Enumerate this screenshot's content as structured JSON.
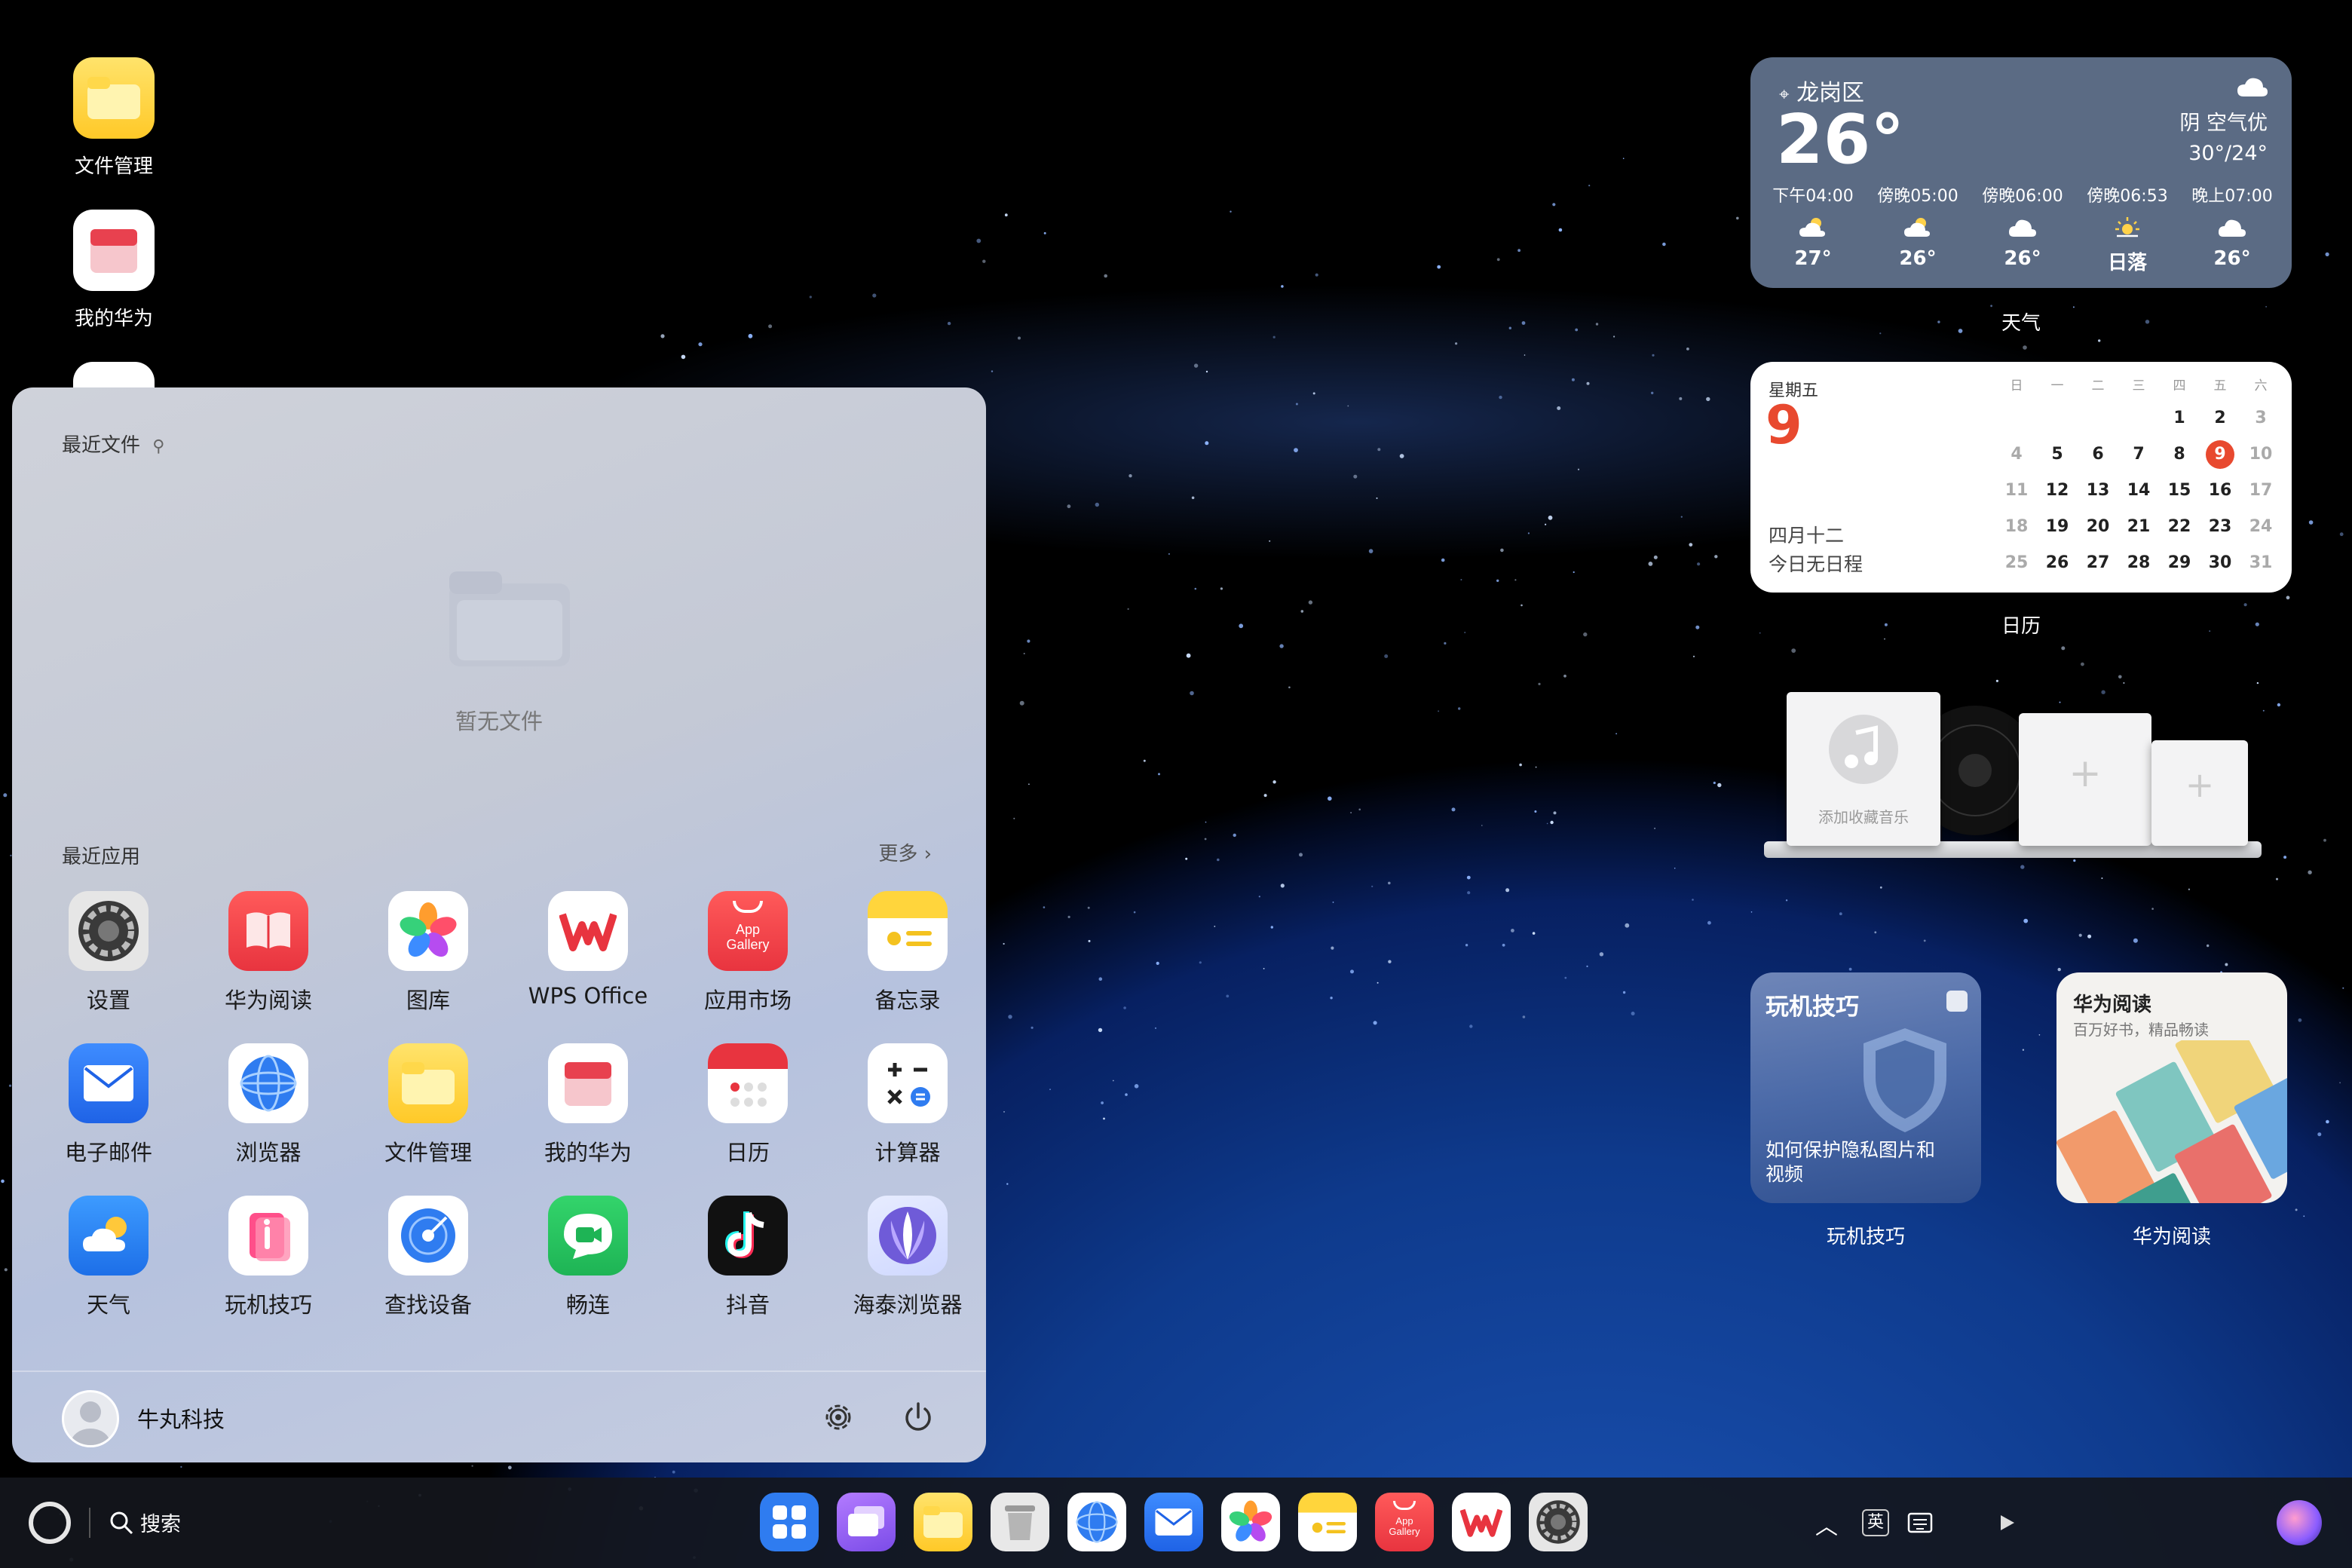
{
  "desktop": {
    "icons": [
      {
        "label": "文件管理",
        "icon": "file-manager-icon"
      },
      {
        "label": "我的华为",
        "icon": "my-huawei-icon"
      }
    ]
  },
  "start_menu": {
    "recent_files_title": "最近文件",
    "empty_text": "暂无文件",
    "recent_apps_title": "最近应用",
    "more_label": "更多",
    "apps": [
      {
        "label": "设置",
        "icon": "settings-icon"
      },
      {
        "label": "华为阅读",
        "icon": "huawei-books-icon"
      },
      {
        "label": "图库",
        "icon": "gallery-icon"
      },
      {
        "label": "WPS Office",
        "icon": "wps-office-icon"
      },
      {
        "label": "应用市场",
        "icon": "app-gallery-icon"
      },
      {
        "label": "备忘录",
        "icon": "notes-icon"
      },
      {
        "label": "电子邮件",
        "icon": "email-icon"
      },
      {
        "label": "浏览器",
        "icon": "browser-icon"
      },
      {
        "label": "文件管理",
        "icon": "file-manager-icon"
      },
      {
        "label": "我的华为",
        "icon": "my-huawei-icon"
      },
      {
        "label": "日历",
        "icon": "calendar-icon"
      },
      {
        "label": "计算器",
        "icon": "calculator-icon"
      },
      {
        "label": "天气",
        "icon": "weather-icon"
      },
      {
        "label": "玩机技巧",
        "icon": "tips-icon"
      },
      {
        "label": "查找设备",
        "icon": "find-device-icon"
      },
      {
        "label": "畅连",
        "icon": "meetime-icon"
      },
      {
        "label": "抖音",
        "icon": "douyin-icon"
      },
      {
        "label": "海泰浏览器",
        "icon": "haitai-browser-icon"
      }
    ],
    "app_gallery_text_1": "App",
    "app_gallery_text_2": "Gallery",
    "user_name": "牛丸科技"
  },
  "weather": {
    "location": "龙岗区",
    "temperature": "26°",
    "condition": "阴  空气优",
    "range": "30°/24°",
    "hourly": [
      {
        "time": "下午04:00",
        "icon": "partly-cloudy-icon",
        "temp": "27°"
      },
      {
        "time": "傍晚05:00",
        "icon": "partly-cloudy-icon",
        "temp": "26°"
      },
      {
        "time": "傍晚06:00",
        "icon": "cloud-icon",
        "temp": "26°"
      },
      {
        "time": "傍晚06:53",
        "icon": "sunset-icon",
        "temp": "日落"
      },
      {
        "time": "晚上07:00",
        "icon": "cloud-icon",
        "temp": "26°"
      }
    ],
    "caption": "天气"
  },
  "calendar": {
    "weekday": "星期五",
    "day": "9",
    "lunar": "四月十二",
    "no_events": "今日无日程",
    "week_headers": [
      "日",
      "一",
      "二",
      "三",
      "四",
      "五",
      "六"
    ],
    "rows": [
      [
        "",
        "",
        "",
        "",
        "1",
        "2",
        "3"
      ],
      [
        "4",
        "5",
        "6",
        "7",
        "8",
        "9",
        "10"
      ],
      [
        "11",
        "12",
        "13",
        "14",
        "15",
        "16",
        "17"
      ],
      [
        "18",
        "19",
        "20",
        "21",
        "22",
        "23",
        "24"
      ],
      [
        "25",
        "26",
        "27",
        "28",
        "29",
        "30",
        "31"
      ]
    ],
    "today": "9",
    "accent": "#e8492f",
    "caption": "日历"
  },
  "music": {
    "add_label": "添加收藏音乐"
  },
  "tips_widget": {
    "title": "玩机技巧",
    "desc_line1": "如何保护隐私图片和",
    "desc_line2": "视频",
    "caption": "玩机技巧"
  },
  "reader_widget": {
    "title": "华为阅读",
    "subtitle": "百万好书，精品畅读",
    "caption": "华为阅读"
  },
  "taskbar": {
    "search_label": "搜索",
    "input_method": "英",
    "apps": [
      "app-center-icon",
      "multi-window-icon",
      "file-manager-icon",
      "trash-icon",
      "browser-icon",
      "email-icon",
      "gallery-icon",
      "notes-icon",
      "app-gallery-icon",
      "wps-office-icon",
      "settings-icon"
    ]
  }
}
